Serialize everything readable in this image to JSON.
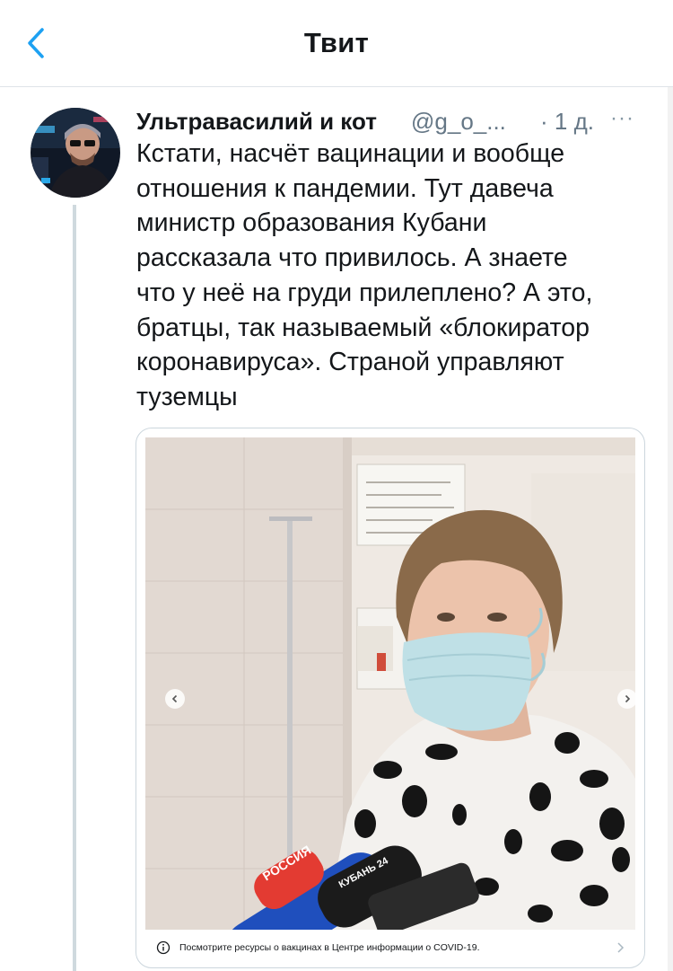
{
  "header": {
    "title": "Твит"
  },
  "tweet": {
    "author_name": "Ультравасилий и кот",
    "author_handle": "@g_o_...",
    "time": "· 1 д.",
    "more": "···",
    "text": "Кстати, насчёт вацинации и вообще\nотношения к пандемии. Тут давеча\nминистр образования Кубани\nрассказала что привилось. А знаете\nчто у неё на груди прилеплено? А это,\nбратцы, так называемый «блокиратор\nкоронавируса». Страной управляют\nтуземцы"
  },
  "media": {
    "covid_notice": "Посмотрите ресурсы о вакцинах в Центре информации о COVID-19.",
    "mic_labels": [
      "РОССИЯ",
      "КУБАНЬ 24"
    ]
  },
  "colors": {
    "accent": "#1da1f2",
    "secondary_text": "#657786",
    "border": "#ccd6dd"
  }
}
